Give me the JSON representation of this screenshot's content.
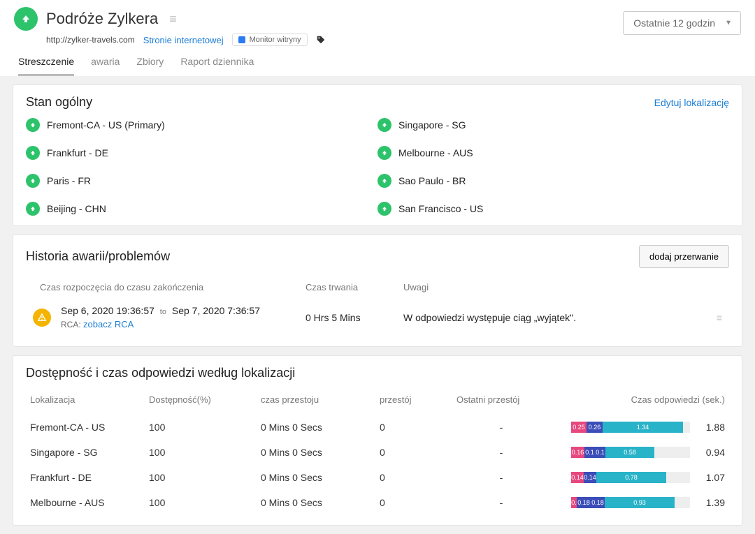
{
  "header": {
    "title": "Podróże Zylkera",
    "url": "http://zylker-travels.com",
    "linkWebsite": "Stronie internetowej",
    "chip": "Monitor witryny",
    "timeRange": "Ostatnie 12 godzin"
  },
  "tabs": [
    "Streszczenie",
    "awaria",
    "Zbiory",
    "Raport dziennika"
  ],
  "status": {
    "title": "Stan ogólny",
    "editLink": "Edytuj lokalizację",
    "left": [
      "Fremont-CA - US (Primary)",
      "Frankfurt - DE",
      "Paris - FR",
      "Beijing - CHN"
    ],
    "right": [
      "Singapore - SG",
      "Melbourne - AUS",
      "Sao Paulo - BR",
      "San Francisco - US"
    ]
  },
  "outage": {
    "title": "Historia awarii/problemów",
    "addBtn": "dodaj przerwanie",
    "colStart": "Czas rozpoczęcia do czasu zakończenia",
    "colDuration": "Czas trwania",
    "colNotes": "Uwagi",
    "row": {
      "start": "Sep 6, 2020 19:36:57",
      "to": "to",
      "end": "Sep 7, 2020 7:36:57",
      "rcaLabel": "RCA:",
      "rcaLink": "zobacz RCA",
      "duration": "0 Hrs 5 Mins",
      "notes": "W odpowiedzi występuje ciąg „wyjątek\"."
    }
  },
  "avail": {
    "title": "Dostępność i czas odpowiedzi według lokalizacji",
    "cols": {
      "loc": "Lokalizacja",
      "availPct": "Dostępność(%)",
      "downtime": "czas przestoju",
      "outages": "przestój",
      "lastOutage": "Ostatni przestój",
      "respTime": "Czas odpowiedzi (sek.)"
    },
    "rows": [
      {
        "loc": "Fremont-CA - US",
        "pct": "100",
        "down": "0 Mins 0 Secs",
        "out": "0",
        "last": "-",
        "segs": [
          [
            "0.25",
            "pink",
            22
          ],
          [
            "0.26",
            "blue",
            23
          ],
          [
            "1.34",
            "teal",
            115
          ]
        ],
        "rt": "1.88"
      },
      {
        "loc": "Singapore - SG",
        "pct": "100",
        "down": "0 Mins 0 Secs",
        "out": "0",
        "last": "-",
        "segs": [
          [
            "0.16",
            "pink",
            19
          ],
          [
            "0.1",
            "blue",
            15
          ],
          [
            "0.1",
            "blue",
            15
          ],
          [
            "0.58",
            "teal",
            70
          ]
        ],
        "rt": "0.94"
      },
      {
        "loc": "Frankfurt - DE",
        "pct": "100",
        "down": "0 Mins 0 Secs",
        "out": "0",
        "last": "-",
        "segs": [
          [
            "0.14",
            "pink",
            18
          ],
          [
            "0.14",
            "blue",
            18
          ],
          [
            "0.78",
            "teal",
            100
          ]
        ],
        "rt": "1.07"
      },
      {
        "loc": "Melbourne - AUS",
        "pct": "100",
        "down": "0 Mins 0 Secs",
        "out": "0",
        "last": "-",
        "segs": [
          [
            "0.",
            "pink",
            8
          ],
          [
            "0.18",
            "blue",
            20
          ],
          [
            "0.18",
            "blue",
            20
          ],
          [
            "0.93",
            "teal",
            100
          ]
        ],
        "rt": "1.39"
      }
    ]
  }
}
